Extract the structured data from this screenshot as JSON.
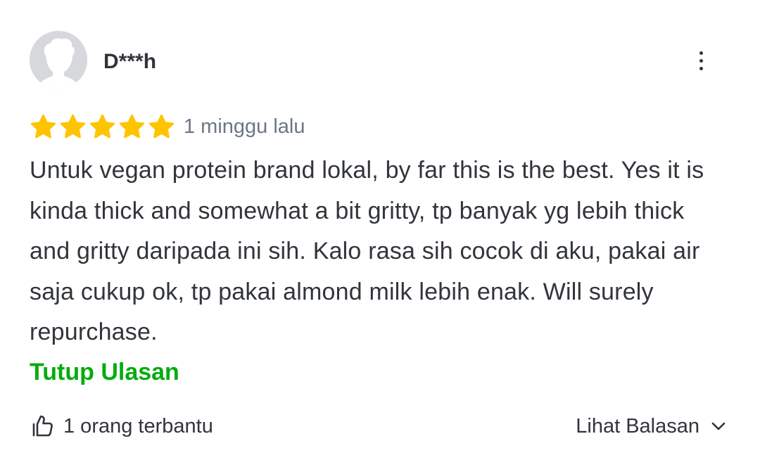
{
  "review": {
    "username": "D***h",
    "rating": 5,
    "max_rating": 5,
    "timestamp": "1 minggu lalu",
    "text": "Untuk vegan protein brand lokal, by far this is the best. Yes it is kinda thick and somewhat a bit gritty, tp banyak yg lebih thick and gritty daripada ini sih. Kalo rasa sih cocok di aku, pakai air saja cukup ok, tp pakai almond milk lebih enak. Will surely repurchase.",
    "collapse_label": "Tutup Ulasan",
    "helpful_label": "1 orang terbantu",
    "replies_label": "Lihat Balasan"
  },
  "icons": {
    "avatar": "default-avatar-icon",
    "more": "more-vertical-icon",
    "star": "star-icon",
    "helpful": "thumbs-up-icon",
    "replies": "chevron-down-icon"
  },
  "colors": {
    "star": "#ffc400",
    "link": "#03ac0e",
    "text": "#31353b",
    "muted": "#6d7588",
    "avatar_bg": "#d6d8dc"
  }
}
